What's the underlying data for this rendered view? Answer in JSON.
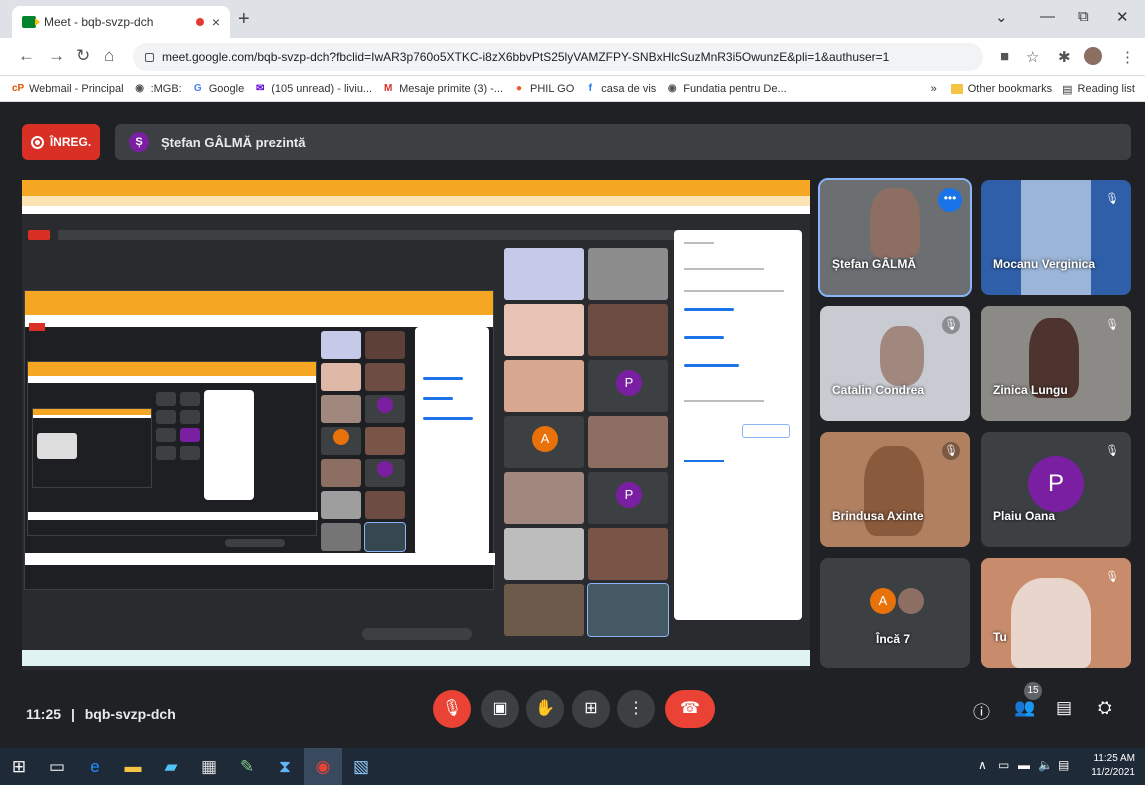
{
  "browser": {
    "tab_title": "Meet - bqb-svzp-dch",
    "tab_close": "×",
    "new_tab": "+",
    "win_min": "—",
    "win_restore": "⧉",
    "win_close": "✕",
    "url": "meet.google.com/bqb-svzp-dch?fbclid=IwAR3p760o5XTKC-i8zX6bbvPtS25lyVAMZFPY-SNBxHlcSuzMnR3i5OwunzE&pli=1&authuser=1"
  },
  "bookmarks": [
    {
      "label": "Webmail - Principal",
      "icon": "cP",
      "color": "#e65100"
    },
    {
      "label": ":MGB:",
      "icon": "◉",
      "color": "#555"
    },
    {
      "label": "Google",
      "icon": "G",
      "color": "#4285f4"
    },
    {
      "label": "(105 unread) - liviu...",
      "icon": "✉",
      "color": "#6001d2"
    },
    {
      "label": "Mesaje primite (3) -...",
      "icon": "M",
      "color": "#d93025"
    },
    {
      "label": "PHIL GO",
      "icon": "●",
      "color": "#f4511e"
    },
    {
      "label": "casa de vis",
      "icon": "f",
      "color": "#1877f2"
    },
    {
      "label": "Fundatia pentru De...",
      "icon": "◉",
      "color": "#555"
    }
  ],
  "bookmarks_more": "»",
  "other_bookmarks": "Other bookmarks",
  "reading_list": "Reading list",
  "meet": {
    "rec_label": "ÎNREG.",
    "presenter_initial": "Ș",
    "presenter_text": "Ștefan GÂLMĂ prezintă",
    "time": "11:25",
    "separator": "|",
    "meeting_code": "bqb-svzp-dch",
    "participant_count": "15",
    "colors": {
      "accent": "#1a73e8",
      "red": "#ea4335",
      "bg": "#202124"
    }
  },
  "tiles": [
    {
      "name": "Ștefan GÂLMĂ"
    },
    {
      "name": "Mocanu Verginica"
    },
    {
      "name": "Catalin Condrea"
    },
    {
      "name": "Zinica Lungu"
    },
    {
      "name": "Brindusa Axinte"
    },
    {
      "name": "Plaiu Oana",
      "initial": "P"
    },
    {
      "name": "Încă 7",
      "initial": "A"
    },
    {
      "name": "Tu"
    }
  ],
  "taskbar": {
    "time": "11:25 AM",
    "date": "11/2/2021"
  }
}
